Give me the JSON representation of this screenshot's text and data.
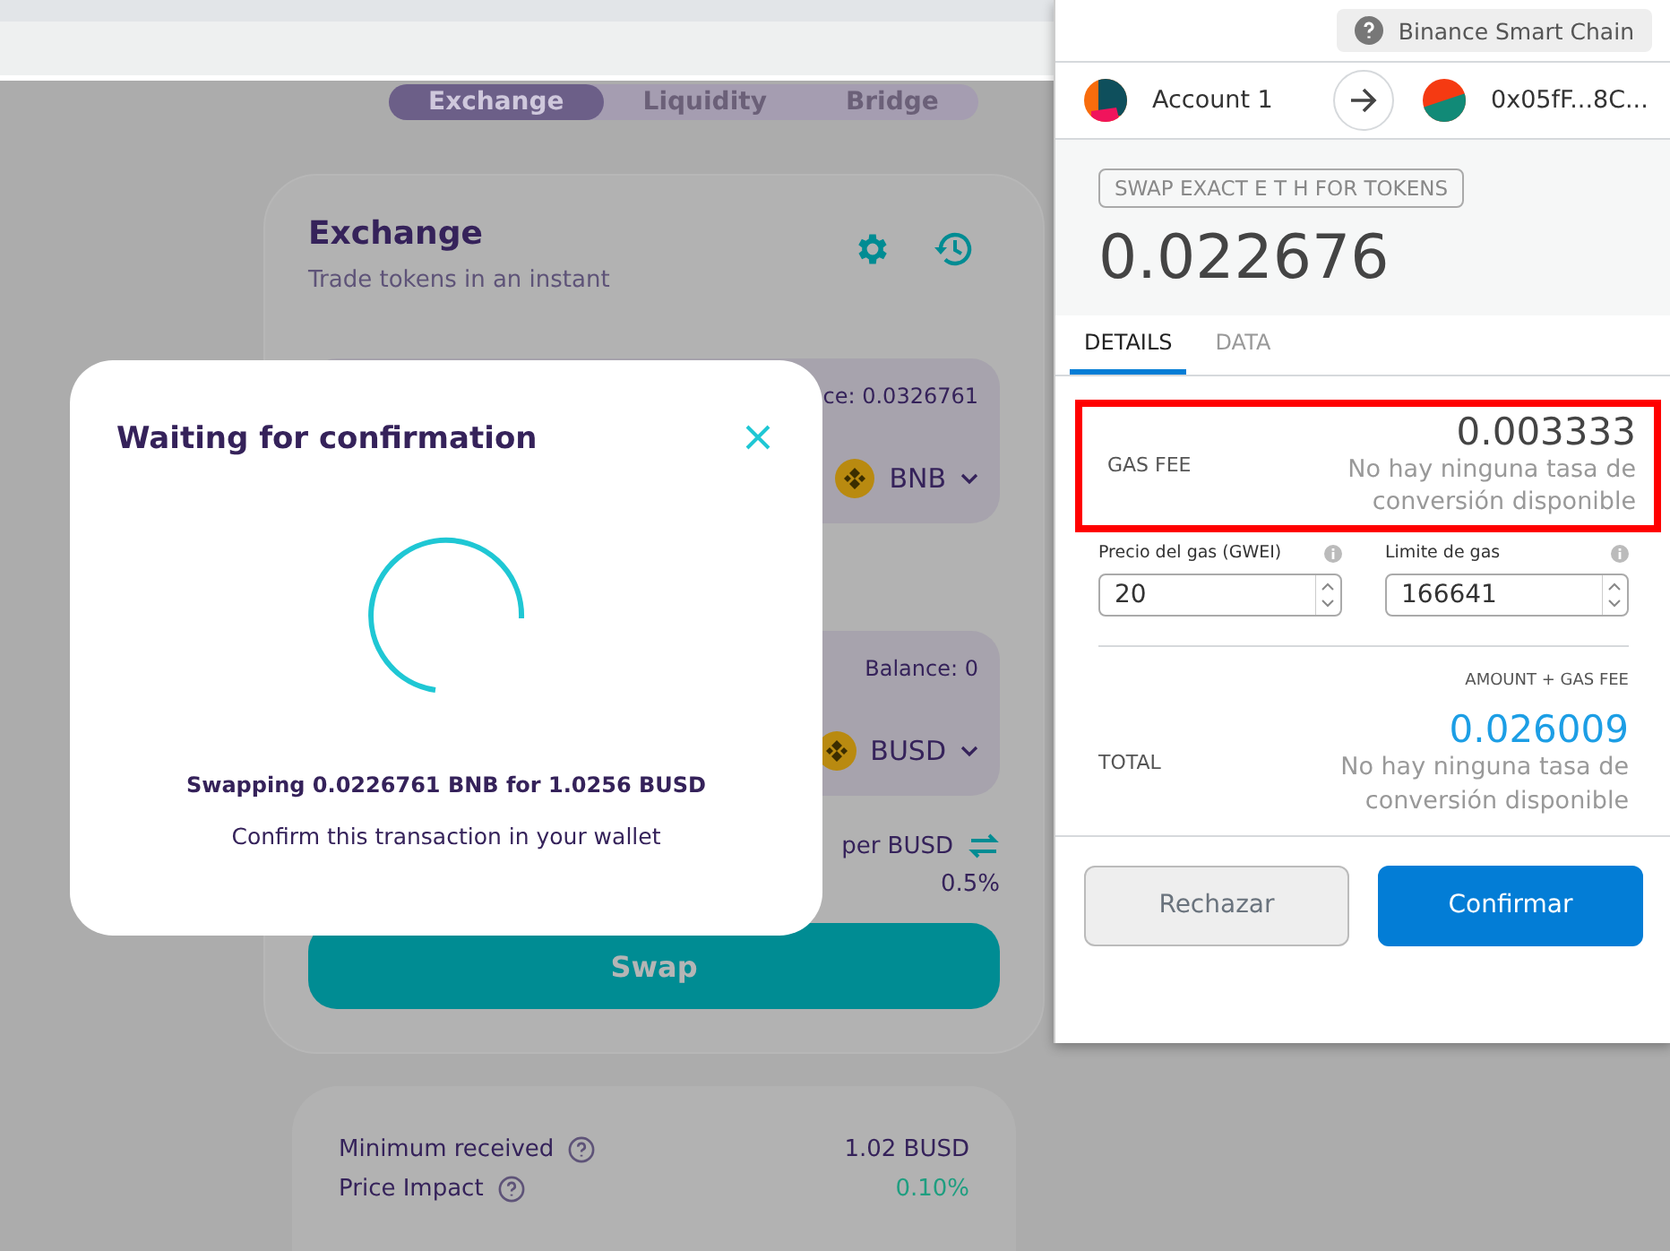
{
  "page": {
    "tabs": [
      {
        "label": "Exchange",
        "selected": true
      },
      {
        "label": "Liquidity",
        "selected": false
      },
      {
        "label": "Bridge",
        "selected": false
      }
    ],
    "exchange": {
      "title": "Exchange",
      "subtitle": "Trade tokens in an instant",
      "from": {
        "balance": "ce: 0.0326761",
        "token": "BNB"
      },
      "to": {
        "balance": "Balance: 0",
        "token": "BUSD"
      },
      "price_unit": "per BUSD",
      "slippage": "0.5%",
      "swap_button": "Swap"
    },
    "details": [
      {
        "label": "Minimum received",
        "value": "1.02 BUSD",
        "kind": "plain"
      },
      {
        "label": "Price Impact",
        "value": "0.10%",
        "kind": "good"
      }
    ]
  },
  "modal": {
    "title": "Waiting for confirmation",
    "summary": "Swapping 0.0226761 BNB for 1.0256 BUSD",
    "hint": "Confirm this transaction in your wallet"
  },
  "wallet": {
    "network": "Binance Smart Chain",
    "from_account": "Account 1",
    "to_account": "0x05fF...8C...",
    "method": "SWAP EXACT E T H FOR TOKENS",
    "amount": "0.022676",
    "tabs": [
      {
        "label": "DETAILS",
        "selected": true
      },
      {
        "label": "DATA",
        "selected": false
      }
    ],
    "gas_fee": {
      "label": "GAS FEE",
      "value": "0.003333",
      "note": "No hay ninguna tasa de conversión disponible",
      "highlighted": true
    },
    "gas_fields": [
      {
        "label": "Precio del gas (GWEI)",
        "value": "20"
      },
      {
        "label": "Limite de gas",
        "value": "166641"
      }
    ],
    "total": {
      "caption": "AMOUNT + GAS FEE",
      "label": "TOTAL",
      "value": "0.026009",
      "note": "No hay ninguna tasa de conversión disponible"
    },
    "buttons": [
      {
        "label": "Rechazar",
        "kind": "secondary"
      },
      {
        "label": "Confirmar",
        "kind": "primary"
      }
    ]
  }
}
